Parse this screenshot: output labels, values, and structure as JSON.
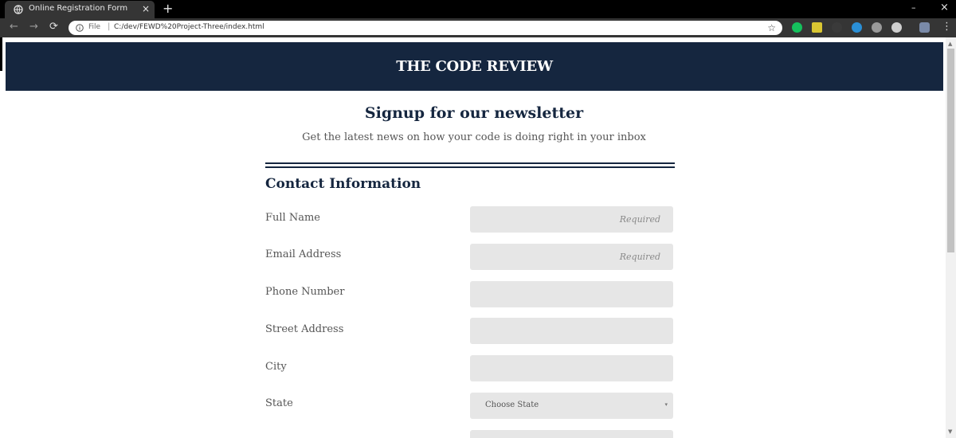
{
  "browser": {
    "tab_title": "Online Registration Form",
    "tab_close": "×",
    "new_tab": "+",
    "window_minimize": "–",
    "window_close": "×",
    "back": "←",
    "forward": "→",
    "reload": "⟳",
    "address_scheme_label": "File",
    "address_separator": "|",
    "address_url": "C:/dev/FEWD%20Project-Three/index.html",
    "bookmark_star": "☆",
    "menu": "⋮",
    "extension_colors": [
      "#15c15d",
      "#d9c632",
      "#3a3a3a",
      "#2a8fd6",
      "#9a9a9a",
      "#cfcfcf",
      "#7a8aa8"
    ]
  },
  "page": {
    "site_title": "THE CODE REVIEW",
    "heading": "Signup for our newsletter",
    "subheading": "Get the latest news on how your code is doing right in your inbox",
    "section_title": "Contact Information",
    "fields": [
      {
        "label": "Full Name",
        "placeholder": "Required",
        "value": ""
      },
      {
        "label": "Email Address",
        "placeholder": "Required",
        "value": ""
      },
      {
        "label": "Phone Number",
        "placeholder": "",
        "value": ""
      },
      {
        "label": "Street Address",
        "placeholder": "",
        "value": ""
      },
      {
        "label": "City",
        "placeholder": "",
        "value": ""
      }
    ],
    "state_field": {
      "label": "State",
      "selected": "Choose State",
      "caret": "▾"
    },
    "colors": {
      "header_bg": "#15263f",
      "input_bg": "#e6e6e6",
      "heading_text": "#15263f"
    }
  }
}
